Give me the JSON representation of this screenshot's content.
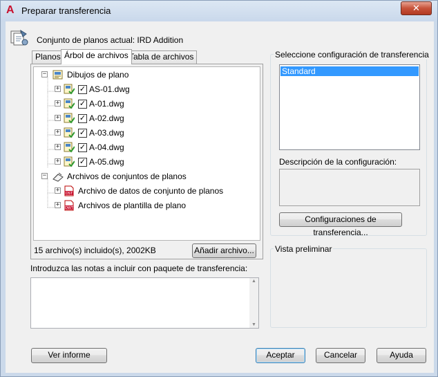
{
  "window": {
    "title": "Preparar transferencia",
    "app_icon_glyph": "A",
    "close_glyph": "✕",
    "accent_color": "#c8102e"
  },
  "header": {
    "current_sheetset_label": "Conjunto de planos actual: IRD Addition"
  },
  "tabs": [
    {
      "label": "Planos",
      "active": false
    },
    {
      "label": "Árbol de archivos",
      "active": true
    },
    {
      "label": "Tabla de archivos",
      "active": false
    }
  ],
  "tree": {
    "group1": {
      "label": "Dibujos de plano",
      "expander": "−",
      "icon": "sheet-drawings-icon",
      "items": [
        {
          "label": "AS-01.dwg",
          "checked": true,
          "expander": "+",
          "icon": "dwg-sheet-icon"
        },
        {
          "label": "A-01.dwg",
          "checked": true,
          "expander": "+",
          "icon": "dwg-sheet-icon"
        },
        {
          "label": "A-02.dwg",
          "checked": true,
          "expander": "+",
          "icon": "dwg-sheet-icon"
        },
        {
          "label": "A-03.dwg",
          "checked": true,
          "expander": "+",
          "icon": "dwg-sheet-icon"
        },
        {
          "label": "A-04.dwg",
          "checked": true,
          "expander": "+",
          "icon": "dwg-sheet-icon"
        },
        {
          "label": "A-05.dwg",
          "checked": true,
          "expander": "+",
          "icon": "dwg-sheet-icon"
        }
      ]
    },
    "group2": {
      "label": "Archivos de conjuntos de planos",
      "expander": "−",
      "icon": "sheetset-files-icon",
      "items": [
        {
          "label": "Archivo de datos de conjunto de planos",
          "expander": "+",
          "icon": "dst-file-icon",
          "badge": "DST"
        },
        {
          "label": "Archivos de plantilla de plano",
          "expander": "+",
          "icon": "dwt-file-icon",
          "badge": "DWT"
        }
      ]
    }
  },
  "footer_left": {
    "files_count": "15 archivo(s) incluido(s), 2002KB",
    "add_file_button": "Añadir archivo..."
  },
  "notes": {
    "label": "Introduzca las notas a incluir con paquete de transferencia:",
    "value": ""
  },
  "transfer_setup": {
    "group_title": "Seleccione configuración de transferencia",
    "options": [
      "Standard"
    ],
    "selected": "Standard",
    "description_label": "Descripción de la configuración:",
    "description_value": "",
    "setups_button": "Configuraciones de transferencia..."
  },
  "preview": {
    "group_title": "Vista preliminar"
  },
  "buttons": {
    "view_report": "Ver informe",
    "ok": "Aceptar",
    "cancel": "Cancelar",
    "help": "Ayuda"
  },
  "colors": {
    "selection": "#3399ff",
    "window_frame": "#cbd9ea",
    "close_button": "#c7533a"
  }
}
